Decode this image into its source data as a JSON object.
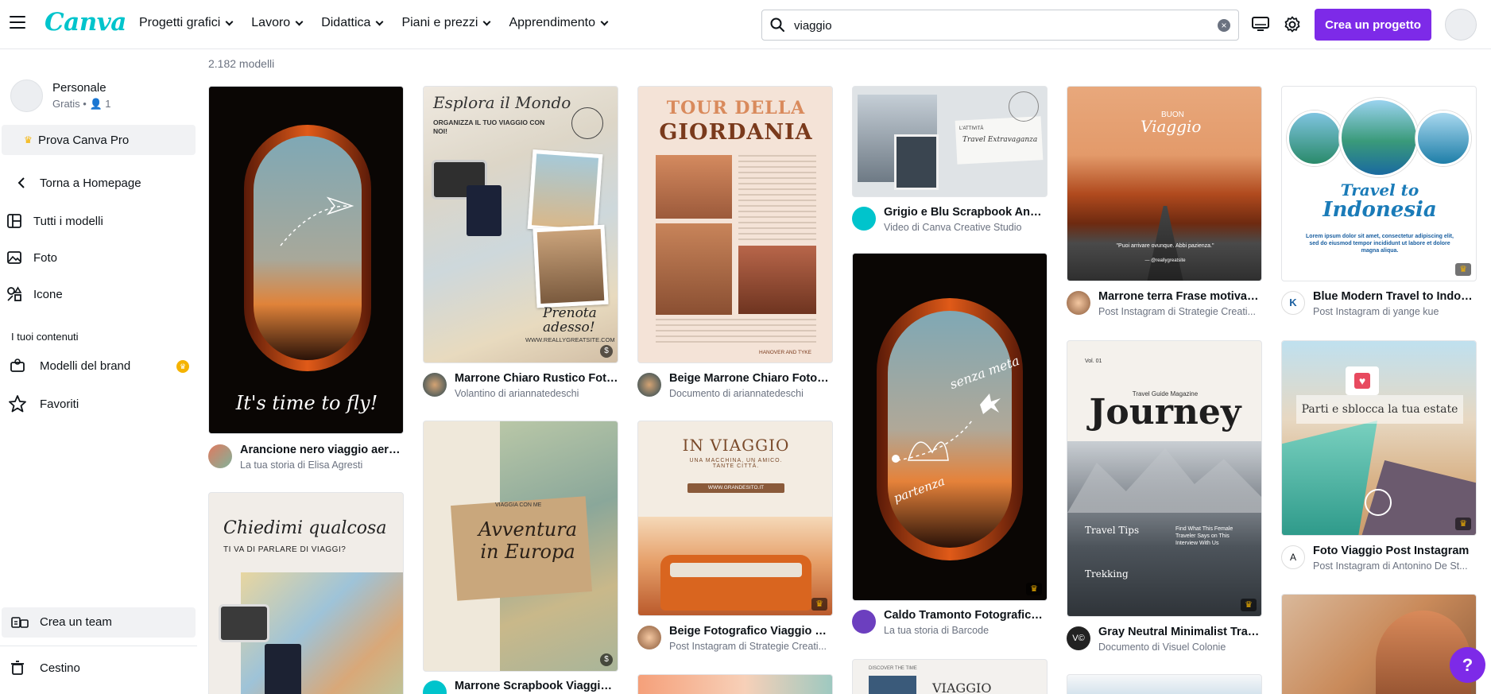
{
  "app": {
    "logo": "Canva"
  },
  "nav": {
    "items": [
      {
        "label": "Progetti grafici"
      },
      {
        "label": "Lavoro"
      },
      {
        "label": "Didattica"
      },
      {
        "label": "Piani e prezzi"
      },
      {
        "label": "Apprendimento"
      }
    ]
  },
  "search": {
    "value": "viaggio",
    "clear_glyph": "×"
  },
  "header": {
    "create_label": "Crea un progetto"
  },
  "sidebar": {
    "profile_name": "Personale",
    "profile_meta": "Gratis • 👤 1",
    "pro_label": "Prova Canva Pro",
    "back_label": "Torna a Homepage",
    "items": [
      {
        "label": "Tutti i modelli",
        "icon": "layout-icon"
      },
      {
        "label": "Foto",
        "icon": "photo-icon"
      },
      {
        "label": "Icone",
        "icon": "shapes-icon"
      }
    ],
    "section_label": "I tuoi contenuti",
    "brand_label": "Modelli del brand",
    "favorites_label": "Favoriti",
    "team_label": "Crea un team",
    "trash_label": "Cestino"
  },
  "results": {
    "count": "2.182 modelli",
    "cards": [
      {
        "title": "Arancione nero viaggio aere...",
        "sub": "La tua storia di Elisa Agresti",
        "overlay": "It's time to fly!"
      },
      {
        "title": "",
        "sub": "",
        "overlay_1": "Chiedimi qualcosa",
        "overlay_2": "TI VA DI PARLARE DI VIAGGI?"
      },
      {
        "title": "Marrone Chiaro Rustico Foto...",
        "sub": "Volantino di ariannatedeschi",
        "overlay_1": "Esplora il Mondo",
        "overlay_2": "ORGANIZZA IL TUO VIAGGIO CON NOI!",
        "overlay_3": "Prenota adesso!",
        "overlay_4": "WWW.REALLYGREATSITE.COM",
        "badge": "$"
      },
      {
        "title": "Marrone Scrapbook Viaggio ...",
        "sub": "",
        "overlay_1": "Avventura in Europa",
        "overlay_2": "VIAGGIA CON ME",
        "badge": "$"
      },
      {
        "title": "Beige Marrone Chiaro Fotogr...",
        "sub": "Documento di ariannatedeschi",
        "overlay_1": "TOUR DELLA",
        "overlay_2": "GIORDANIA",
        "overlay_3": "HANOVER AND TYKE"
      },
      {
        "title": "Beige Fotografico Viaggio Po...",
        "sub": "Post Instagram di Strategie Creati...",
        "overlay_1": "IN VIAGGIO",
        "overlay_2": "UNA MACCHINA, UN AMICO. TANTE CITTÀ.",
        "overlay_3": "WWW.GRANDESITO.IT"
      },
      {
        "title": "Grigio e Blu Scrapbook Annu...",
        "sub": "Video di Canva Creative Studio",
        "overlay_1": "L'ATTIVITÀ",
        "overlay_2": "Travel Extravaganza"
      },
      {
        "title": "Caldo Tramonto Fotografico ...",
        "sub": "La tua storia di Barcode",
        "overlay_1": "senza meta",
        "overlay_2": "partenza"
      },
      {
        "title": "",
        "sub": "",
        "overlay_1": "VIAGGIO",
        "overlay_2": "DISCOVER THE TIME"
      },
      {
        "title": "Marrone terra Frase motivaz...",
        "sub": "Post Instagram di Strategie Creati...",
        "overlay_1": "BUON",
        "overlay_2": "Viaggio",
        "overlay_3": "\"Puoi arrivare ovunque. Abbi pazienza.\"",
        "overlay_4": "— @reallygreatsite"
      },
      {
        "title": "Gray Neutral Minimalist Trav...",
        "sub": "Documento di Visuel Colonie",
        "overlay_1": "Vol. 01",
        "overlay_2": "Travel Guide Magazine",
        "overlay_3": "Journey",
        "overlay_4": "Travel Tips",
        "overlay_5": "Trekking",
        "overlay_6": "Find What This Female Traveler Says on This Interview With Us",
        "avatar_text": "V©"
      },
      {
        "title": "Blue Modern Travel to Indon...",
        "sub": "Post Instagram di yange kue",
        "overlay_1": "Travel to",
        "overlay_2": "Indonesia",
        "overlay_3": "Lorem ipsum dolor sit amet, consectetur adipiscing elit, sed do eiusmod tempor incididunt ut labore et dolore magna aliqua."
      },
      {
        "title": "Foto Viaggio Post Instagram",
        "sub": "Post Instagram di Antonino De St...",
        "overlay_1": "Parti e sblocca la tua estate"
      }
    ]
  },
  "colors": {
    "brand": "#00c4cc",
    "accent": "#7d2ae8",
    "pro": "#f5b300"
  },
  "help": {
    "label": "?"
  }
}
